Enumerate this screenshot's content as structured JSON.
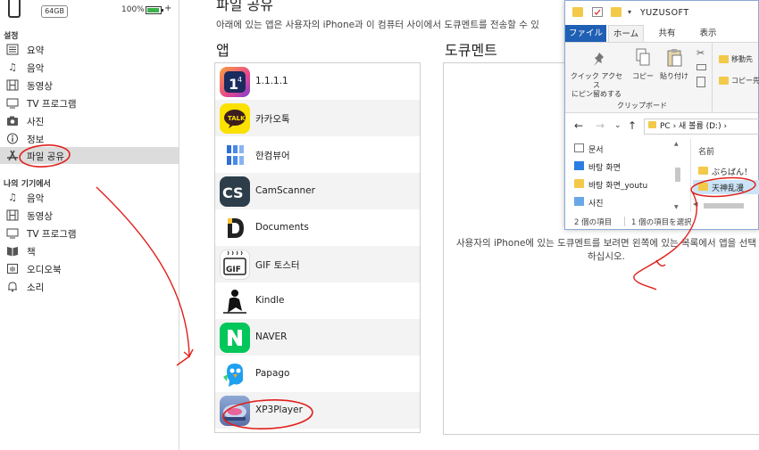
{
  "device": {
    "capacity": "64GB",
    "battery": "100%"
  },
  "sidebar": {
    "settings_title": "설정",
    "settings_items": [
      {
        "label": "요약",
        "icon": "summary-icon"
      },
      {
        "label": "음악",
        "icon": "music-icon"
      },
      {
        "label": "동영상",
        "icon": "film-icon"
      },
      {
        "label": "TV 프로그램",
        "icon": "tv-icon"
      },
      {
        "label": "사진",
        "icon": "camera-icon"
      },
      {
        "label": "정보",
        "icon": "info-icon"
      },
      {
        "label": "파일 공유",
        "icon": "app-store-icon",
        "selected": true
      }
    ],
    "device_title": "나의 기기에서",
    "device_items": [
      {
        "label": "음악",
        "icon": "music-icon"
      },
      {
        "label": "동영상",
        "icon": "film-icon"
      },
      {
        "label": "TV 프로그램",
        "icon": "tv-icon"
      },
      {
        "label": "책",
        "icon": "book-icon"
      },
      {
        "label": "오디오북",
        "icon": "audiobook-icon"
      },
      {
        "label": "소리",
        "icon": "bell-icon"
      }
    ]
  },
  "main": {
    "title": "파일 공유",
    "description": "아래에 있는 앱은 사용자의 iPhone과 이 컴퓨터 사이에서 도큐멘트를 전송할 수 있",
    "apps_heading": "앱",
    "docs_heading": "도큐멘트",
    "apps": [
      {
        "name": "1.1.1.1"
      },
      {
        "name": "카카오톡"
      },
      {
        "name": "한컴뷰어"
      },
      {
        "name": "CamScanner"
      },
      {
        "name": "Documents"
      },
      {
        "name": "GIF 토스터"
      },
      {
        "name": "Kindle"
      },
      {
        "name": "NAVER"
      },
      {
        "name": "Papago"
      },
      {
        "name": "XP3Player"
      }
    ],
    "docs_hint": "사용자의 iPhone에 있는 도큐멘트를 보려면 왼쪽에 있는 목록에서 앱을 선택하십시오."
  },
  "explorer": {
    "title": "YUZUSOFT",
    "tabs": [
      "ファイル",
      "ホーム",
      "共有",
      "表示"
    ],
    "ribbon": {
      "pin_label": "クイック アクセス\nにピン留めする",
      "copy_label": "コピー",
      "paste_label": "貼り付け",
      "clipboard_group": "クリップボード",
      "move_label": "移動先",
      "copy_to_label": "コピー先"
    },
    "address_segments": [
      "PC",
      "새 볼륨 (D:)",
      "YUZUSOFT"
    ],
    "address_text": "PC  ›  새 볼륨 (D:)  ›",
    "tree": [
      "문서",
      "바탕 화면",
      "바탕 화면_youtu",
      "사진"
    ],
    "column_name": "名前",
    "files": [
      "ぶらばん！",
      "天神乱漫"
    ],
    "status_items": "2 個の項目",
    "status_selected": "1 個の項目を選択"
  },
  "colors": {
    "accent_blue": "#1f5fb4",
    "annotation_red": "#e0201c",
    "battery_green": "#3bb34a",
    "folder_yellow": "#f3c94a"
  }
}
